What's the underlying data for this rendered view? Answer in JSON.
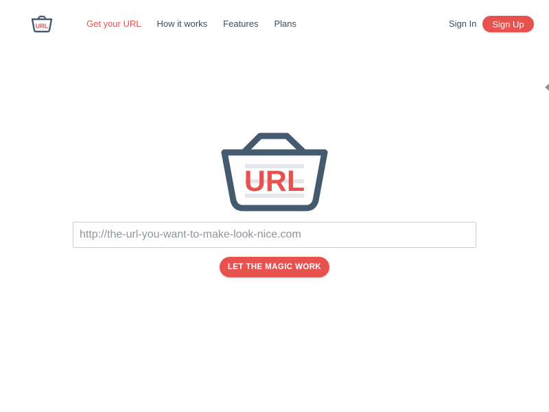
{
  "header": {
    "logo_text": "URL",
    "nav": [
      {
        "label": "Get your URL",
        "active": true
      },
      {
        "label": "How it works",
        "active": false
      },
      {
        "label": "Features",
        "active": false
      },
      {
        "label": "Plans",
        "active": false
      }
    ],
    "signin_label": "Sign In",
    "signup_label": "Sign Up"
  },
  "hero": {
    "logo_text": "URL",
    "url_input": {
      "value": "",
      "placeholder": "http://the-url-you-want-to-make-look-nice.com"
    },
    "submit_label": "LET THE MAGIC WORK"
  },
  "colors": {
    "accent": "#e8524e",
    "navy": "#435a6f",
    "text": "#3d4d5c"
  },
  "icons": {
    "logo": "basket-icon",
    "edge": "caret-left-icon"
  }
}
